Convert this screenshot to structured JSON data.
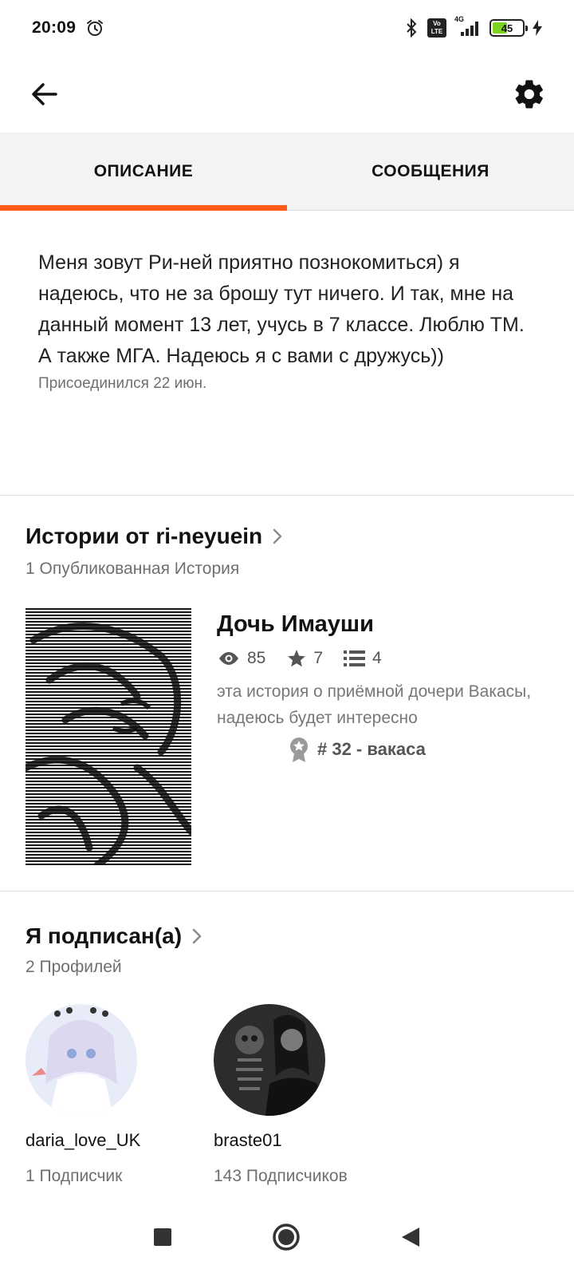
{
  "status_bar": {
    "time": "20:09",
    "network": "4G",
    "volte": "Vo LTE",
    "battery": "45",
    "battery_level": 0.45
  },
  "tabs": [
    {
      "label": "ОПИСАНИЕ",
      "active": true
    },
    {
      "label": "СООБЩЕНИЯ",
      "active": false
    }
  ],
  "about": {
    "text": "Меня зовут Ри-ней приятно познокомиться) я надеюсь, что не за брошу тут ничего. И так, мне на данный момент 13 лет, учусь в 7 классе. Люблю ТМ. А также МГА. Надеюсь я с вами с дружусь))",
    "joined": "Присоединился 22 июн."
  },
  "stories_section": {
    "title": "Истории от ri-neyuein",
    "subtitle": "1 Опубликованная История",
    "story": {
      "title": "Дочь Имауши",
      "views": "85",
      "votes": "7",
      "parts": "4",
      "description": "эта история о приёмной дочери Вакасы, надеюсь будет интересно",
      "rank": "# 32 - вакаса"
    }
  },
  "following_section": {
    "title": "Я подписан(а)",
    "subtitle": "2 Профилей",
    "profiles": [
      {
        "name": "daria_love_UK",
        "followers": "1 Подписчик"
      },
      {
        "name": "braste01",
        "followers": "143 Подписчиков"
      }
    ]
  },
  "colors": {
    "accent": "#ff5a14",
    "tab_background": "#f4f3f4",
    "secondary_text": "#6f6f6f"
  },
  "icons": [
    "back-arrow-icon",
    "gear-icon",
    "eye-icon",
    "star-icon",
    "list-icon",
    "medal-icon",
    "chevron-right-icon",
    "recents-icon",
    "home-icon",
    "back-triangle-icon"
  ]
}
